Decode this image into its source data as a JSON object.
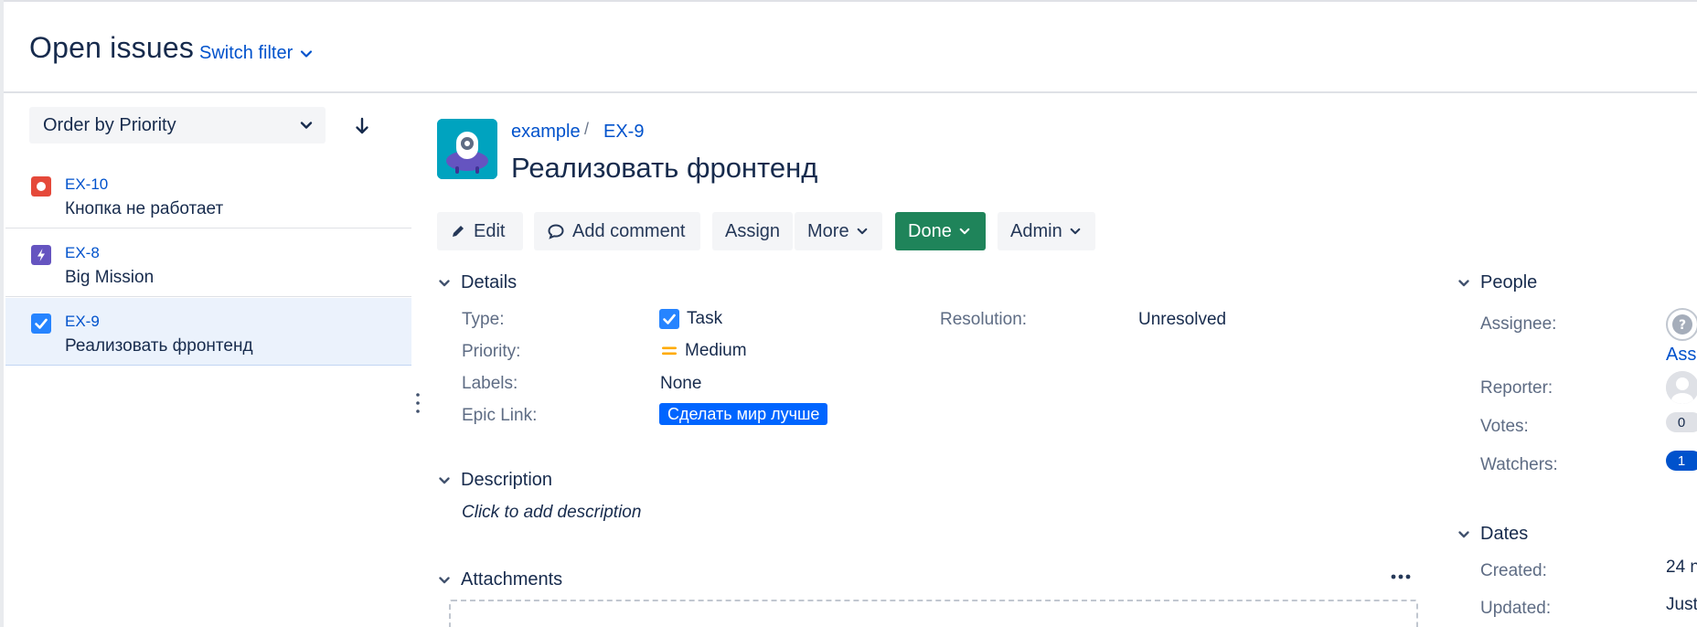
{
  "header": {
    "title": "Open issues",
    "switch_filter": "Switch filter"
  },
  "sidebar": {
    "order_by": "Order by Priority",
    "issues": [
      {
        "key": "EX-10",
        "summary": "Кнопка не работает",
        "type_icon": "bug-icon",
        "color": "#e5493a"
      },
      {
        "key": "EX-8",
        "summary": "Big Mission",
        "type_icon": "epic-icon",
        "color": "#6554c0"
      },
      {
        "key": "EX-9",
        "summary": "Реализовать фронтенд",
        "type_icon": "task-icon",
        "color": "#2684ff",
        "selected": true
      }
    ]
  },
  "issue": {
    "project": "example",
    "key": "EX-9",
    "title": "Реализовать фронтенд"
  },
  "toolbar": {
    "edit": "Edit",
    "add_comment": "Add comment",
    "assign": "Assign",
    "more": "More",
    "done": "Done",
    "admin": "Admin"
  },
  "details": {
    "heading": "Details",
    "type_label": "Type:",
    "type_value": "Task",
    "priority_label": "Priority:",
    "priority_value": "Medium",
    "labels_label": "Labels:",
    "labels_value": "None",
    "epic_label": "Epic Link:",
    "epic_value": "Сделать мир лучше",
    "resolution_label": "Resolution:",
    "resolution_value": "Unresolved"
  },
  "description": {
    "heading": "Description",
    "placeholder": "Click to add description"
  },
  "attachments": {
    "heading": "Attachments"
  },
  "people": {
    "heading": "People",
    "assignee_label": "Assignee:",
    "assign_link": "Assi",
    "reporter_label": "Reporter:",
    "votes_label": "Votes:",
    "votes": "0",
    "watchers_label": "Watchers:",
    "watchers": "1"
  },
  "dates": {
    "heading": "Dates",
    "created_label": "Created:",
    "created_value": "24 n",
    "updated_label": "Updated:",
    "updated_value": "Just"
  },
  "colors": {
    "link": "#0052cc",
    "done_button": "#1f845a",
    "epic_lozenge": "#0065ff",
    "selected_row": "#ebf2fc",
    "priority_medium": "#ffab00"
  }
}
